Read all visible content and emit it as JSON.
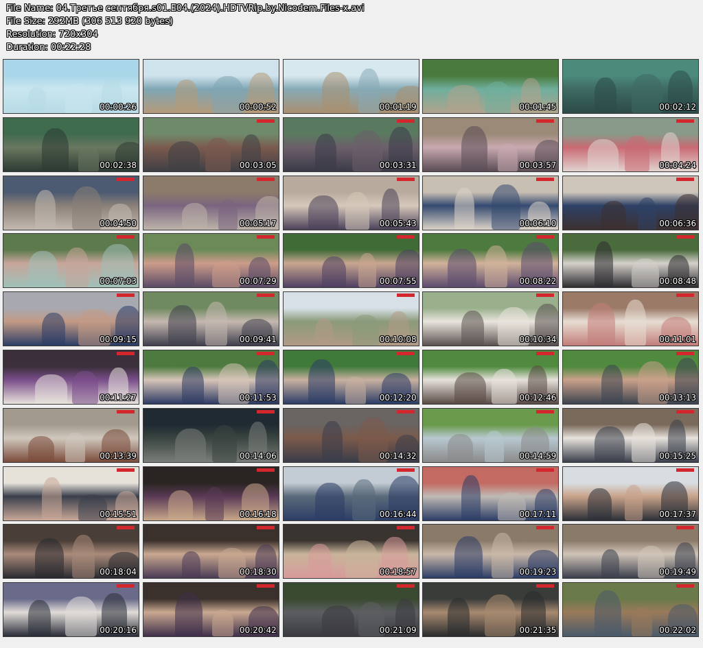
{
  "info": {
    "file_name": "File Name: 04.Третье сентября.s01.E04.(2024).HDTVRip.by.Nicodem.Files-x.avi",
    "file_size": "File Size: 292MB (306 513 920 bytes)",
    "resolution": "Resolution: 720x304",
    "duration": "Duration: 00:22:28"
  },
  "thumbnails": [
    {
      "time": "00:00:26",
      "scene": [
        "#a9d6e8",
        "#c9e6ef",
        "#b7dbe6"
      ],
      "channel_logo": false
    },
    {
      "time": "00:00:52",
      "scene": [
        "#cfe3ec",
        "#7fa6b4",
        "#b59a7a"
      ],
      "channel_logo": false
    },
    {
      "time": "00:01:19",
      "scene": [
        "#d8e8ef",
        "#86aab6",
        "#a98f70"
      ],
      "channel_logo": false
    },
    {
      "time": "00:01:45",
      "scene": [
        "#4a7a3c",
        "#6fae9d",
        "#b0a38c"
      ],
      "channel_logo": false
    },
    {
      "time": "00:02:12",
      "scene": [
        "#4c8a7c",
        "#3e6a62",
        "#2c4a48"
      ],
      "channel_logo": false
    },
    {
      "time": "00:02:38",
      "scene": [
        "#3f6b4f",
        "#6a7760",
        "#2c3a33"
      ],
      "channel_logo": false
    },
    {
      "time": "00:03:05",
      "scene": [
        "#6f8a6a",
        "#7b5a4e",
        "#3f3f45"
      ],
      "channel_logo": true
    },
    {
      "time": "00:03:31",
      "scene": [
        "#5a7a5f",
        "#6c5f6a",
        "#3b3a48"
      ],
      "channel_logo": true
    },
    {
      "time": "00:03:57",
      "scene": [
        "#9c8a78",
        "#c9a9b0",
        "#5a4c55"
      ],
      "channel_logo": true
    },
    {
      "time": "00:04:24",
      "scene": [
        "#8a9a8a",
        "#c96a73",
        "#e1d4d0"
      ],
      "channel_logo": true
    },
    {
      "time": "00:04:50",
      "scene": [
        "#4c5a72",
        "#8a8078",
        "#c3b9b0"
      ],
      "channel_logo": true
    },
    {
      "time": "00:05:17",
      "scene": [
        "#8c7a6a",
        "#7a6580",
        "#bdb3a9"
      ],
      "channel_logo": true
    },
    {
      "time": "00:05:43",
      "scene": [
        "#b8aa9c",
        "#d6c8ba",
        "#4b4159"
      ],
      "channel_logo": true
    },
    {
      "time": "00:06:10",
      "scene": [
        "#c8bfb3",
        "#344a70",
        "#dcd3c9"
      ],
      "channel_logo": true
    },
    {
      "time": "00:06:36",
      "scene": [
        "#cfc6bb",
        "#2d4166",
        "#3d3030"
      ],
      "channel_logo": true
    },
    {
      "time": "00:07:03",
      "scene": [
        "#5d7a4d",
        "#c7a59a",
        "#9fc0b8"
      ],
      "channel_logo": true
    },
    {
      "time": "00:07:29",
      "scene": [
        "#6c8a58",
        "#cc9c8a",
        "#5a4a66"
      ],
      "channel_logo": true
    },
    {
      "time": "00:07:55",
      "scene": [
        "#3f6b36",
        "#c9a690",
        "#4e3f63"
      ],
      "channel_logo": true
    },
    {
      "time": "00:08:22",
      "scene": [
        "#4d7a3e",
        "#d1b29a",
        "#5b4a6e"
      ],
      "channel_logo": true
    },
    {
      "time": "00:08:48",
      "scene": [
        "#4a6b3c",
        "#d4d0ca",
        "#2d2c30"
      ],
      "channel_logo": true
    },
    {
      "time": "00:09:15",
      "scene": [
        "#a8a8b0",
        "#c29a85",
        "#2c3d66"
      ],
      "channel_logo": true
    },
    {
      "time": "00:09:41",
      "scene": [
        "#6f8a60",
        "#c5b8b0",
        "#3f3f4d"
      ],
      "channel_logo": true
    },
    {
      "time": "00:10:08",
      "scene": [
        "#d6e0e6",
        "#8a9a7a",
        "#b19a86"
      ],
      "channel_logo": true
    },
    {
      "time": "00:10:34",
      "scene": [
        "#9ab08c",
        "#e9e4dd",
        "#5a5250"
      ],
      "channel_logo": true
    },
    {
      "time": "00:11:01",
      "scene": [
        "#9b7a68",
        "#e7ddd2",
        "#c37d7a"
      ],
      "channel_logo": true
    },
    {
      "time": "00:11:27",
      "scene": [
        "#3a2f3a",
        "#7a4d8a",
        "#e8e2dc"
      ],
      "channel_logo": true
    },
    {
      "time": "00:11:53",
      "scene": [
        "#4d7a3e",
        "#d6c4b8",
        "#2d3a63"
      ],
      "channel_logo": true
    },
    {
      "time": "00:12:20",
      "scene": [
        "#3f7a3a",
        "#c8b0a0",
        "#2c3d66"
      ],
      "channel_logo": true
    },
    {
      "time": "00:12:46",
      "scene": [
        "#4f8a3e",
        "#e7e1dc",
        "#5a4a45"
      ],
      "channel_logo": true
    },
    {
      "time": "00:13:13",
      "scene": [
        "#4f8a3e",
        "#c9a08a",
        "#3d4450"
      ],
      "channel_logo": true
    },
    {
      "time": "00:13:39",
      "scene": [
        "#a39a8e",
        "#d0c8bd",
        "#7a4a3a"
      ],
      "channel_logo": true
    },
    {
      "time": "00:14:06",
      "scene": [
        "#1f2a33",
        "#3a4440",
        "#7a7e7a"
      ],
      "channel_logo": true
    },
    {
      "time": "00:14:32",
      "scene": [
        "#6a6462",
        "#7b5a4a",
        "#3a3d4a"
      ],
      "channel_logo": true
    },
    {
      "time": "00:14:59",
      "scene": [
        "#6a9a4c",
        "#b8c8d0",
        "#8a8a8a"
      ],
      "channel_logo": true
    },
    {
      "time": "00:15:25",
      "scene": [
        "#7a6a5c",
        "#e7e2dc",
        "#3a3f4c"
      ],
      "channel_logo": true
    },
    {
      "time": "00:15:51",
      "scene": [
        "#e6e2da",
        "#3a3f4c",
        "#c9a898"
      ],
      "channel_logo": true
    },
    {
      "time": "00:16:18",
      "scene": [
        "#2a2522",
        "#5a3a55",
        "#c8a88a"
      ],
      "channel_logo": true
    },
    {
      "time": "00:16:44",
      "scene": [
        "#c3ccd4",
        "#5a6a7a",
        "#2c3d66"
      ],
      "channel_logo": true
    },
    {
      "time": "00:17:11",
      "scene": [
        "#c36a62",
        "#bfbab4",
        "#2c3d66"
      ],
      "channel_logo": true
    },
    {
      "time": "00:17:37",
      "scene": [
        "#d8dde2",
        "#c9a38a",
        "#2c3038"
      ],
      "channel_logo": true
    },
    {
      "time": "00:18:04",
      "scene": [
        "#4a3e38",
        "#a98a7a",
        "#2a2a30"
      ],
      "channel_logo": true
    },
    {
      "time": "00:18:30",
      "scene": [
        "#3a302c",
        "#c9a890",
        "#4a3a55"
      ],
      "channel_logo": true
    },
    {
      "time": "00:18:57",
      "scene": [
        "#3a3430",
        "#c8b49a",
        "#d89a9a"
      ],
      "channel_logo": true
    },
    {
      "time": "00:19:23",
      "scene": [
        "#8a7a6a",
        "#c9b8a8",
        "#2c3d66"
      ],
      "channel_logo": true
    },
    {
      "time": "00:19:49",
      "scene": [
        "#8a7a6a",
        "#d0c4b8",
        "#3a3f4c"
      ],
      "channel_logo": true
    },
    {
      "time": "00:20:16",
      "scene": [
        "#6a6a8a",
        "#e0dcd8",
        "#2a2d38"
      ],
      "channel_logo": true
    },
    {
      "time": "00:20:42",
      "scene": [
        "#3a302c",
        "#c9a890",
        "#3f2f4a"
      ],
      "channel_logo": true
    },
    {
      "time": "00:21:09",
      "scene": [
        "#3a4a30",
        "#5c5e62",
        "#3a3a40"
      ],
      "channel_logo": true
    },
    {
      "time": "00:21:35",
      "scene": [
        "#3a3c3a",
        "#a88a70",
        "#2a2c2e"
      ],
      "channel_logo": true
    },
    {
      "time": "00:22:02",
      "scene": [
        "#6a7a4a",
        "#9a7a5a",
        "#4a5a6a"
      ],
      "channel_logo": true
    }
  ]
}
